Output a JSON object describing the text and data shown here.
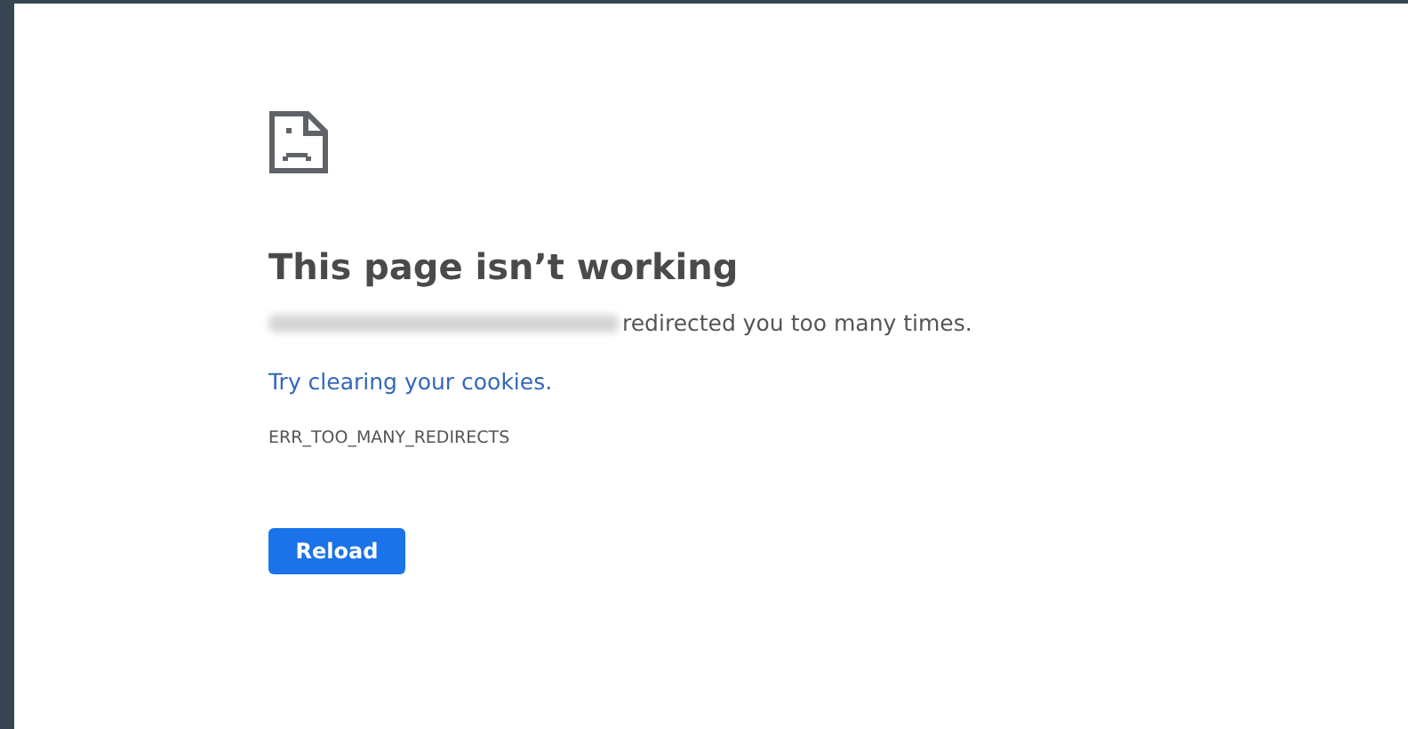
{
  "error_page": {
    "title": "This page isn’t working",
    "message": "redirected you too many times.",
    "suggestion_link": "Try clearing your cookies.",
    "error_code": "ERR_TOO_MANY_REDIRECTS",
    "buttons": [
      "Reload"
    ]
  }
}
